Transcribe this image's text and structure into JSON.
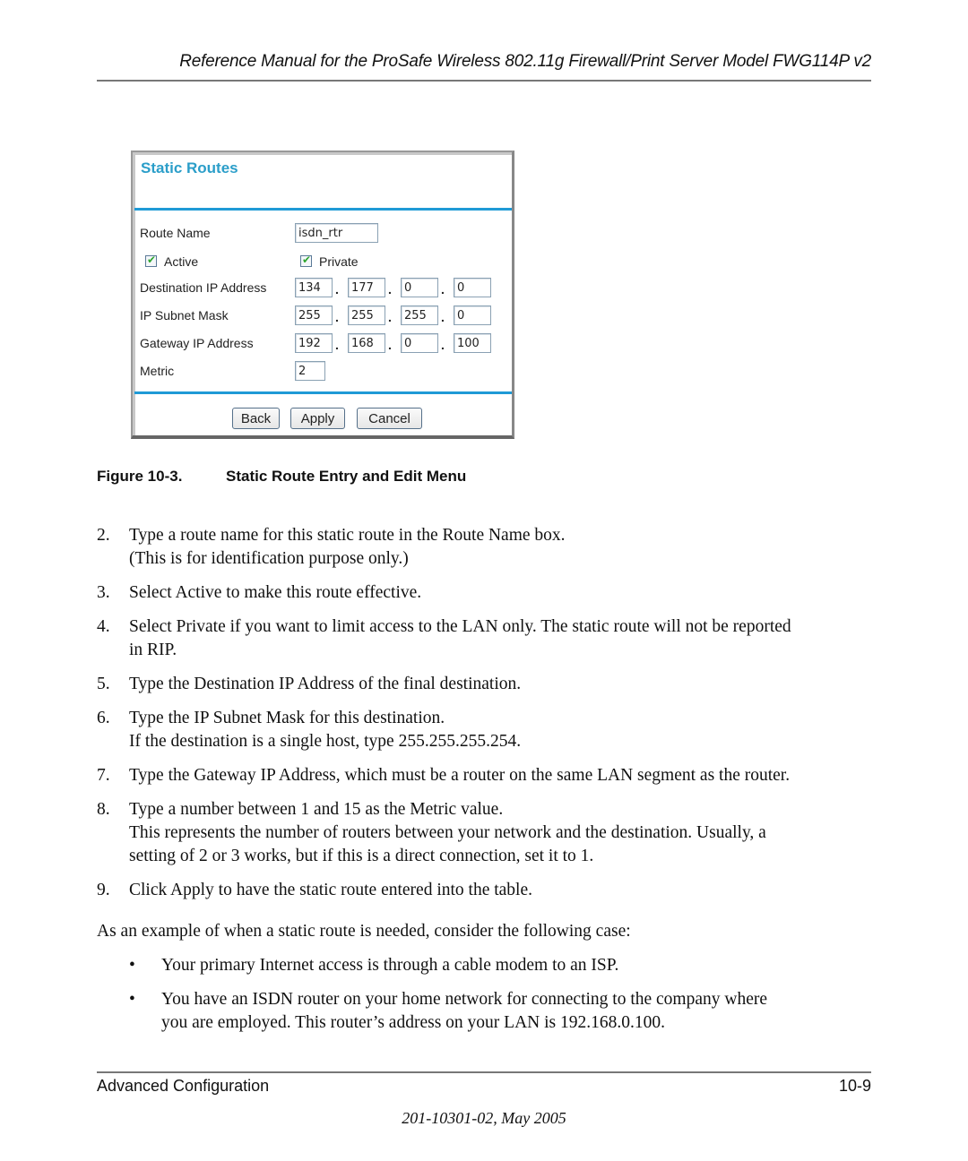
{
  "header": {
    "title": "Reference Manual for the ProSafe Wireless 802.11g  Firewall/Print Server Model FWG114P v2"
  },
  "screenshot": {
    "title": "Static Routes",
    "route_name_label": "Route Name",
    "route_name_value": "isdn_rtr",
    "active_label": "Active",
    "active_checked": true,
    "private_label": "Private",
    "private_checked": true,
    "checkmark": "✔",
    "dest_ip_label": "Destination IP Address",
    "dest_ip": [
      "134",
      "177",
      "0",
      "0"
    ],
    "subnet_label": "IP Subnet Mask",
    "subnet": [
      "255",
      "255",
      "255",
      "0"
    ],
    "gateway_label": "Gateway IP Address",
    "gateway": [
      "192",
      "168",
      "0",
      "100"
    ],
    "metric_label": "Metric",
    "metric_value": "2",
    "dot": ".",
    "buttons": {
      "back": "Back",
      "apply": "Apply",
      "cancel": "Cancel"
    },
    "colors": {
      "title": "#2b9ec9",
      "rule": "#1f9ad6",
      "check": "#2ea52e"
    }
  },
  "caption": {
    "figure": "Figure 10-3.",
    "text": "Static Route Entry and Edit Menu"
  },
  "steps": [
    {
      "num": "2.",
      "lines": [
        "Type a route name for this static route in the Route Name box.",
        "(This is for identification purpose only.)"
      ]
    },
    {
      "num": "3.",
      "lines": [
        "Select Active to make this route effective."
      ]
    },
    {
      "num": "4.",
      "lines": [
        "Select Private if you want to limit access to the LAN only. The static route will not be reported",
        "in RIP."
      ]
    },
    {
      "num": "5.",
      "lines": [
        "Type the Destination IP Address of the final destination."
      ]
    },
    {
      "num": "6.",
      "lines": [
        "Type the IP Subnet Mask for this destination.",
        "If the destination is a single host, type 255.255.255.254."
      ]
    },
    {
      "num": "7.",
      "lines": [
        "Type the Gateway IP Address, which must be a router on the same LAN segment as the router."
      ]
    },
    {
      "num": "8.",
      "lines": [
        "Type a number between 1 and 15 as the Metric value.",
        "This represents the number of routers between your network and the destination. Usually, a",
        "setting of 2 or 3 works, but if this is a direct connection, set it to 1."
      ]
    },
    {
      "num": "9.",
      "lines": [
        "Click Apply to have the static route entered into the table."
      ]
    }
  ],
  "example_intro": "As an example of when a static route is needed, consider the following case:",
  "bullets": [
    {
      "mark": "•",
      "lines": [
        "Your primary Internet access is through a cable modem to an ISP."
      ]
    },
    {
      "mark": "•",
      "lines": [
        "You have an ISDN router on your home network for connecting to the company where",
        "you are employed. This router’s address on your LAN is 192.168.0.100."
      ]
    }
  ],
  "footer": {
    "section": "Advanced Configuration",
    "page": "10-9",
    "doc_id": "201-10301-02, May 2005"
  }
}
